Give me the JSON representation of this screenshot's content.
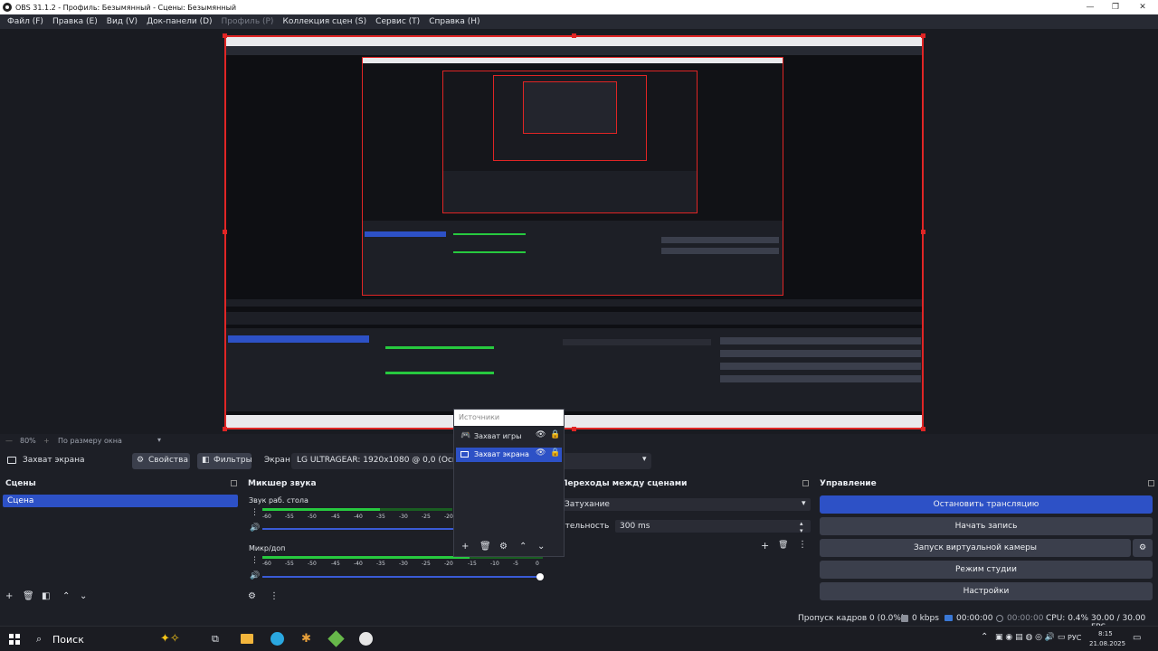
{
  "window": {
    "title": "OBS 31.1.2 - Профиль: Безымянный - Сцены: Безымянный",
    "controls": [
      "—",
      "❐",
      "✕"
    ]
  },
  "menu": [
    {
      "label": "Файл (F)",
      "disabled": false
    },
    {
      "label": "Правка (E)",
      "disabled": false
    },
    {
      "label": "Вид (V)",
      "disabled": false
    },
    {
      "label": "Док-панели (D)",
      "disabled": false
    },
    {
      "label": "Профиль (P)",
      "disabled": true
    },
    {
      "label": "Коллекция сцен (S)",
      "disabled": false
    },
    {
      "label": "Сервис (T)",
      "disabled": false
    },
    {
      "label": "Справка (H)",
      "disabled": false
    }
  ],
  "preview_bar": {
    "zoom": "80%",
    "fit_mode": "По размеру окна"
  },
  "source_toolbar": {
    "source_name": "Захват экрана",
    "properties_label": "Свойства",
    "filters_label": "Фильтры",
    "screen_label": "Экран",
    "screen_value": "LG ULTRAGEAR: 1920x1080 @ 0,0 (Основной)"
  },
  "sources_popup": {
    "title": "Источники",
    "items": [
      {
        "label": "Захват игры",
        "selected": false,
        "icon": "gamepad-icon"
      },
      {
        "label": "Захват экрана",
        "selected": true,
        "icon": "monitor-icon"
      }
    ]
  },
  "scenes": {
    "title": "Сцены",
    "items": [
      {
        "label": "Сцена",
        "selected": true
      }
    ]
  },
  "mixer": {
    "title": "Микшер звука",
    "channels": [
      {
        "name": "Звук раб. стола",
        "level": 0.42
      },
      {
        "name": "Микр/доп",
        "level": 0.74
      }
    ],
    "ticks": [
      "-60",
      "-55",
      "-50",
      "-45",
      "-40",
      "-35",
      "-30",
      "-25",
      "-20",
      "-15",
      "-10",
      "-5",
      "0"
    ]
  },
  "transitions": {
    "title": "Переходы между сценами",
    "type": "Затухание",
    "duration_label": "Длительность",
    "duration_value": "300 ms"
  },
  "controls": {
    "title": "Управление",
    "stop_stream": "Остановить трансляцию",
    "start_recording": "Начать запись",
    "virtual_camera": "Запуск виртуальной камеры",
    "studio_mode": "Режим студии",
    "settings": "Настройки"
  },
  "status": {
    "dropped_frames": "Пропуск кадров 0 (0.0%)",
    "bitrate": "0 kbps",
    "stream_time": "00:00:00",
    "record_time": "00:00:00",
    "cpu": "CPU: 0.4%",
    "fps": "30.00 / 30.00 FPS"
  },
  "taskbar": {
    "search_placeholder": "Поиск",
    "language": "РУС",
    "time": "8:15",
    "date": "21.08.2025"
  },
  "colors": {
    "accent": "#2d51c6",
    "selection_red": "#e02525",
    "panel": "#1d1f26",
    "button": "#3b3f4c"
  }
}
